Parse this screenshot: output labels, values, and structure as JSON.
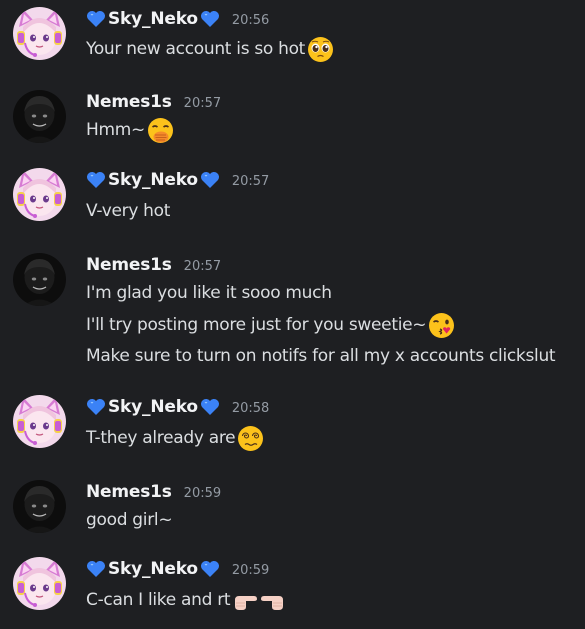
{
  "colors": {
    "background": "#1e1f22",
    "username": "#f2f3f5",
    "message_text": "#dbdee1",
    "timestamp": "#949ba4",
    "heart": "#3b82f6"
  },
  "messages": [
    {
      "author": "Sky_Neko",
      "avatar": "cat-ear-headset-avatar",
      "time": "20:56",
      "lines": [
        {
          "text": "Your new account is so hot",
          "emoji": "pleading-face-emoji"
        }
      ]
    },
    {
      "author": "Nemes1s",
      "avatar": "dark-avatar",
      "time": "20:57",
      "lines": [
        {
          "text": "Hmm~",
          "emoji": "hand-over-mouth-emoji"
        }
      ]
    },
    {
      "author": "Sky_Neko",
      "avatar": "cat-ear-headset-avatar",
      "time": "20:57",
      "lines": [
        {
          "text": "V-very hot"
        }
      ]
    },
    {
      "author": "Nemes1s",
      "avatar": "dark-avatar",
      "time": "20:57",
      "lines": [
        {
          "text": "I'm glad you like it sooo much"
        },
        {
          "text": "I'll try posting more just for you sweetie~",
          "emoji": "kissing-face-emoji"
        },
        {
          "text": "Make sure to turn on notifs for all my x accounts clickslut"
        }
      ]
    },
    {
      "author": "Sky_Neko",
      "avatar": "cat-ear-headset-avatar",
      "time": "20:58",
      "lines": [
        {
          "text": "T-they already are",
          "emoji": "woozy-dizzy-face-emoji"
        }
      ]
    },
    {
      "author": "Nemes1s",
      "avatar": "dark-avatar",
      "time": "20:59",
      "lines": [
        {
          "text": "good girl~"
        }
      ]
    },
    {
      "author": "Sky_Neko",
      "avatar": "cat-ear-headset-avatar",
      "time": "20:59",
      "lines": [
        {
          "text": "C-can I like and rt",
          "emoji": "pointing-fingers-emoji"
        }
      ]
    }
  ]
}
